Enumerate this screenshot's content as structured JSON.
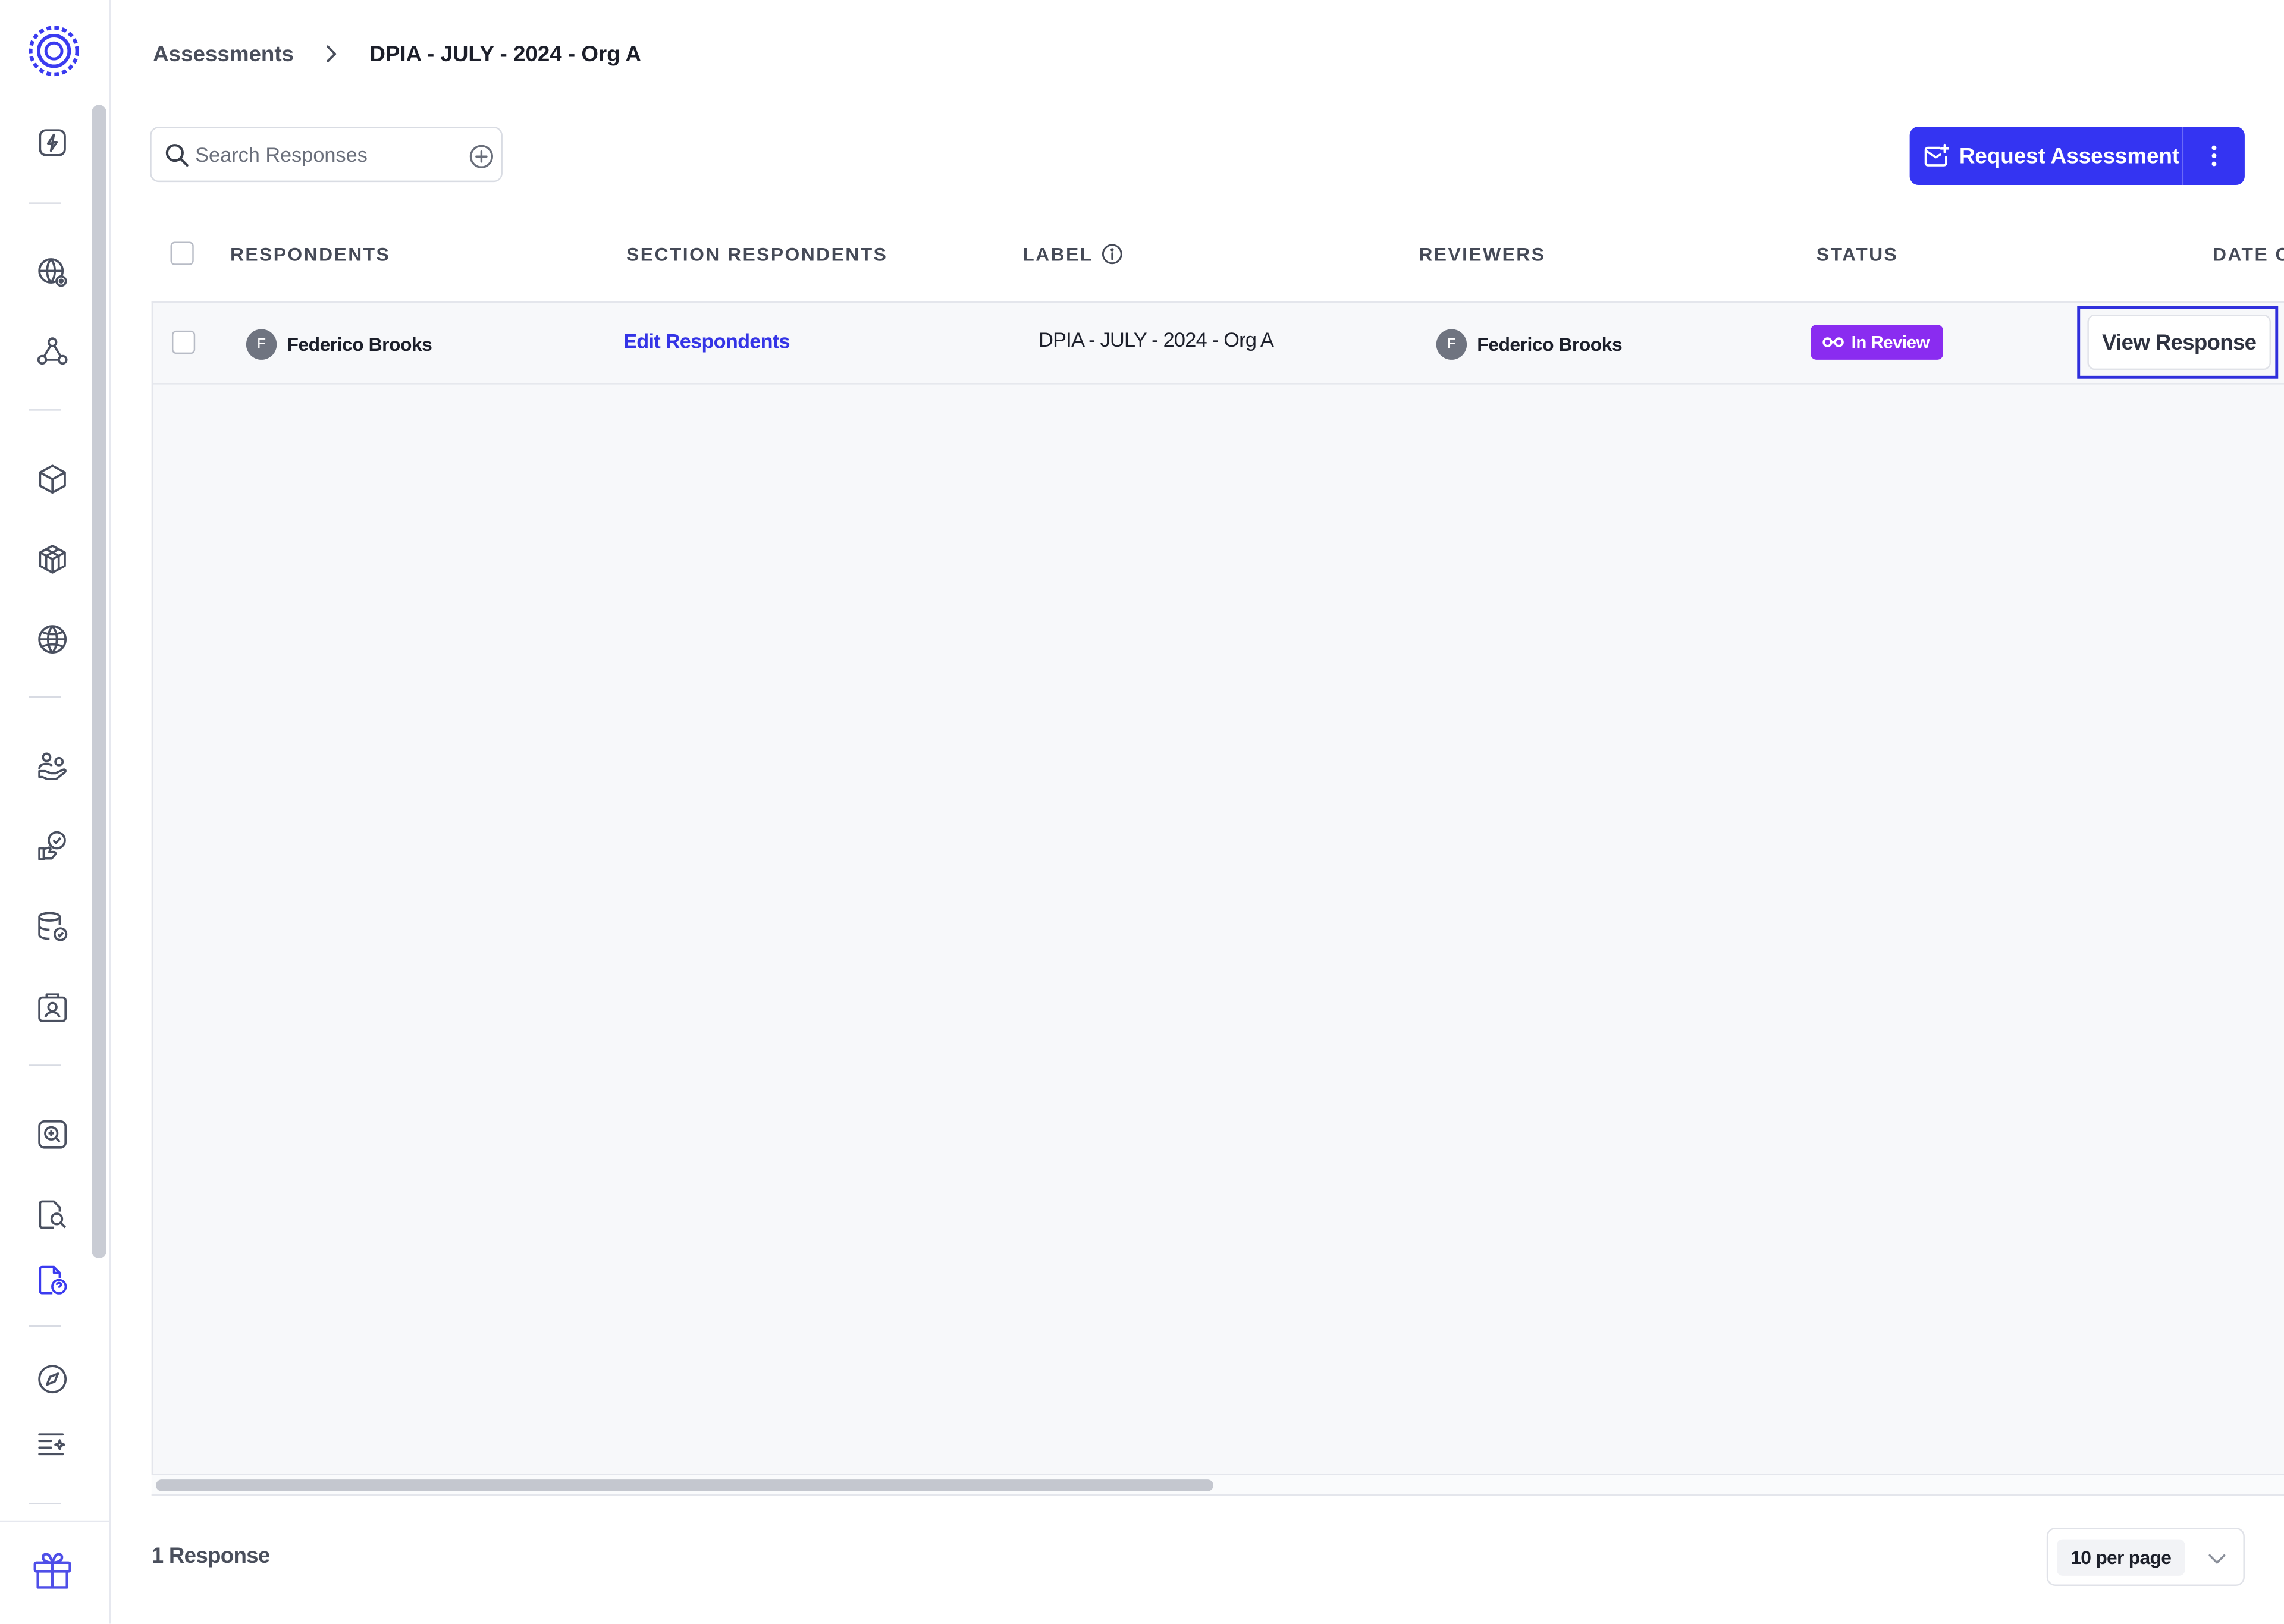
{
  "breadcrumb": {
    "parent": "Assessments",
    "current": "DPIA - JULY - 2024 - Org A"
  },
  "search": {
    "placeholder": "Search Responses",
    "value": ""
  },
  "toolbar": {
    "request_label": "Request Assessment"
  },
  "sidebar": {
    "icons": [
      "bolt-icon",
      "globe-settings-icon",
      "share-nodes-icon",
      "cube-icon",
      "cubes-icon",
      "globe-icon",
      "people-hand-icon",
      "hand-check-icon",
      "database-check-icon",
      "contact-card-icon",
      "search-box-icon",
      "document-search-icon",
      "document-question-icon",
      "compass-icon",
      "list-sparkle-icon",
      "gift-icon"
    ],
    "active_icon": "document-question-icon"
  },
  "table": {
    "columns": {
      "respondents": "RESPONDENTS",
      "section_respondents": "SECTION RESPONDENTS",
      "label": "LABEL",
      "reviewers": "REVIEWERS",
      "status": "STATUS",
      "date": "DATE C"
    },
    "rows": [
      {
        "respondent_initial": "F",
        "respondent_name": "Federico Brooks",
        "section_action": "Edit Respondents",
        "label": "DPIA - JULY - 2024 - Org A",
        "reviewer_initial": "F",
        "reviewer_name": "Federico Brooks",
        "status": "In Review",
        "action": "View Response"
      }
    ]
  },
  "footer": {
    "count": "1 Response",
    "per_page": "10 per page"
  },
  "colors": {
    "accent": "#3434f2",
    "status_in_review": "#8a2cf0",
    "link": "#3434e6"
  }
}
